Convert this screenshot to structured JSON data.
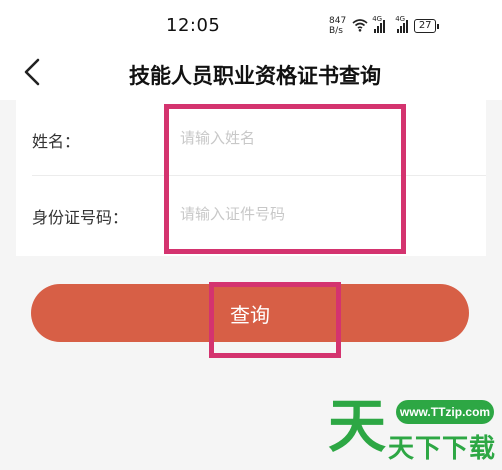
{
  "status_bar": {
    "time": "12:05",
    "net_speed_value": "847",
    "net_speed_unit": "B/s",
    "signal_1_label": "4G",
    "signal_2_label": "4G",
    "battery": "27"
  },
  "nav": {
    "title": "技能人员职业资格证书查询"
  },
  "form": {
    "name_label": "姓名：",
    "name_placeholder": "请输入姓名",
    "name_value": "",
    "id_label": "身份证号码：",
    "id_placeholder": "请输入证件号码",
    "id_value": ""
  },
  "actions": {
    "submit_label": "查询"
  },
  "watermark": {
    "glyph": "天",
    "site": "www.TTzip.com",
    "text": "天下下载"
  },
  "colors": {
    "button": "#d75f46",
    "highlight": "#d4336f",
    "watermark": "#2da744"
  },
  "icons": {
    "back": "chevron-left-icon",
    "wifi": "wifi-icon",
    "signal": "signal-icon",
    "battery": "battery-icon"
  }
}
